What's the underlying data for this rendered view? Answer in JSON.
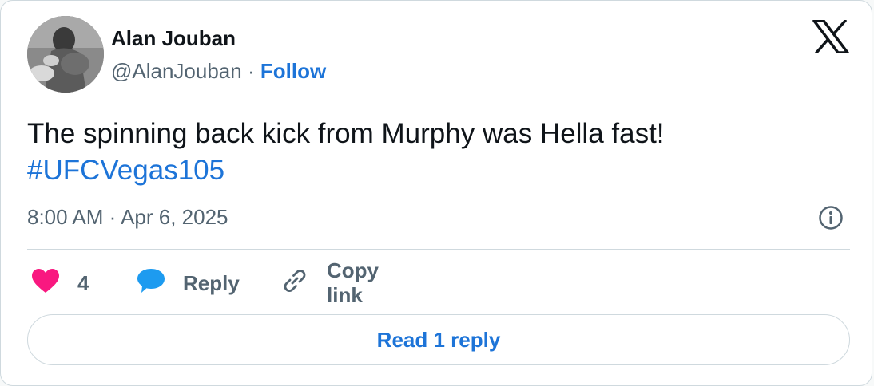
{
  "author": {
    "name": "Alan Jouban",
    "handle": "@AlanJouban",
    "separator": "·",
    "follow_label": "Follow"
  },
  "tweet": {
    "text": "The spinning back kick from Murphy was Hella fast!",
    "hashtag": "#UFCVegas105",
    "timestamp": "8:00 AM · Apr 6, 2025"
  },
  "actions": {
    "like_count": "4",
    "reply_label": "Reply",
    "copy_link_label": "Copy link"
  },
  "read_reply_label": "Read 1 reply",
  "colors": {
    "accent": "#1d74d8",
    "like": "#f91880",
    "reply_bubble": "#1d9bf0",
    "text": "#0f1419",
    "muted": "#536471"
  },
  "icons": [
    "x-logo-icon",
    "info-icon",
    "heart-icon",
    "reply-bubble-icon",
    "link-icon"
  ]
}
